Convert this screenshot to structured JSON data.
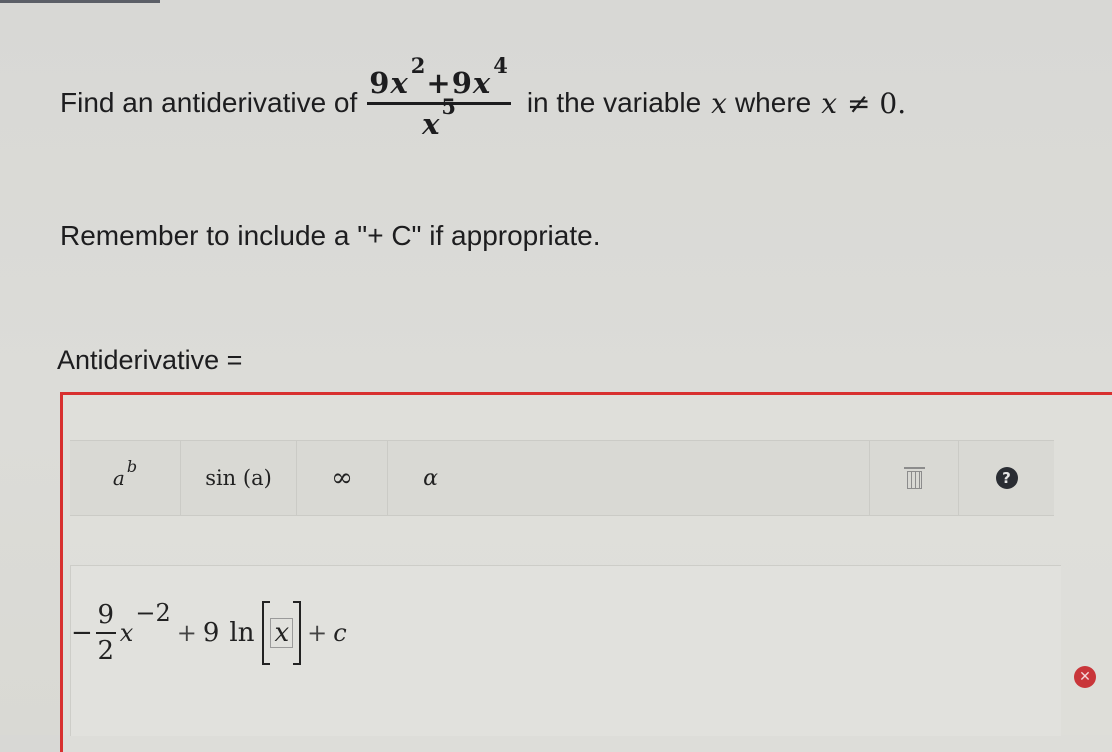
{
  "question": {
    "prefix": "Find an antiderivative of",
    "fraction": {
      "numerator": {
        "c1": "9",
        "v1": "x",
        "e1": "2",
        "op": "+",
        "c2": "9",
        "v2": "x",
        "e2": "4"
      },
      "denominator": {
        "v": "x",
        "e": "5"
      }
    },
    "middle": "in the variable",
    "variable": "x",
    "where_word": "where",
    "condition_var": "x",
    "condition": "≠ 0."
  },
  "reminder": "Remember to include a \"+ C\" if appropriate.",
  "answer_label": "Antiderivative =",
  "toolbar": {
    "power_base": "a",
    "power_exp": "b",
    "sin_label": "sin (a)",
    "infinity_label": "∞",
    "alpha_label": "α",
    "trash_icon": "trash-icon",
    "help_icon": "help-icon",
    "help_glyph": "?"
  },
  "answer_expression": {
    "sign": "−",
    "frac_num": "9",
    "frac_den": "2",
    "var": "x",
    "exp": "−2",
    "plus1": "+",
    "coef": "9",
    "ln": "ln",
    "abs_var": "x",
    "plus2": "+",
    "const": "c"
  },
  "status": {
    "error_icon": "error-x-icon",
    "error_glyph": "✕",
    "error_color": "#c9363a"
  },
  "colors": {
    "focus_border": "#d8302f"
  }
}
